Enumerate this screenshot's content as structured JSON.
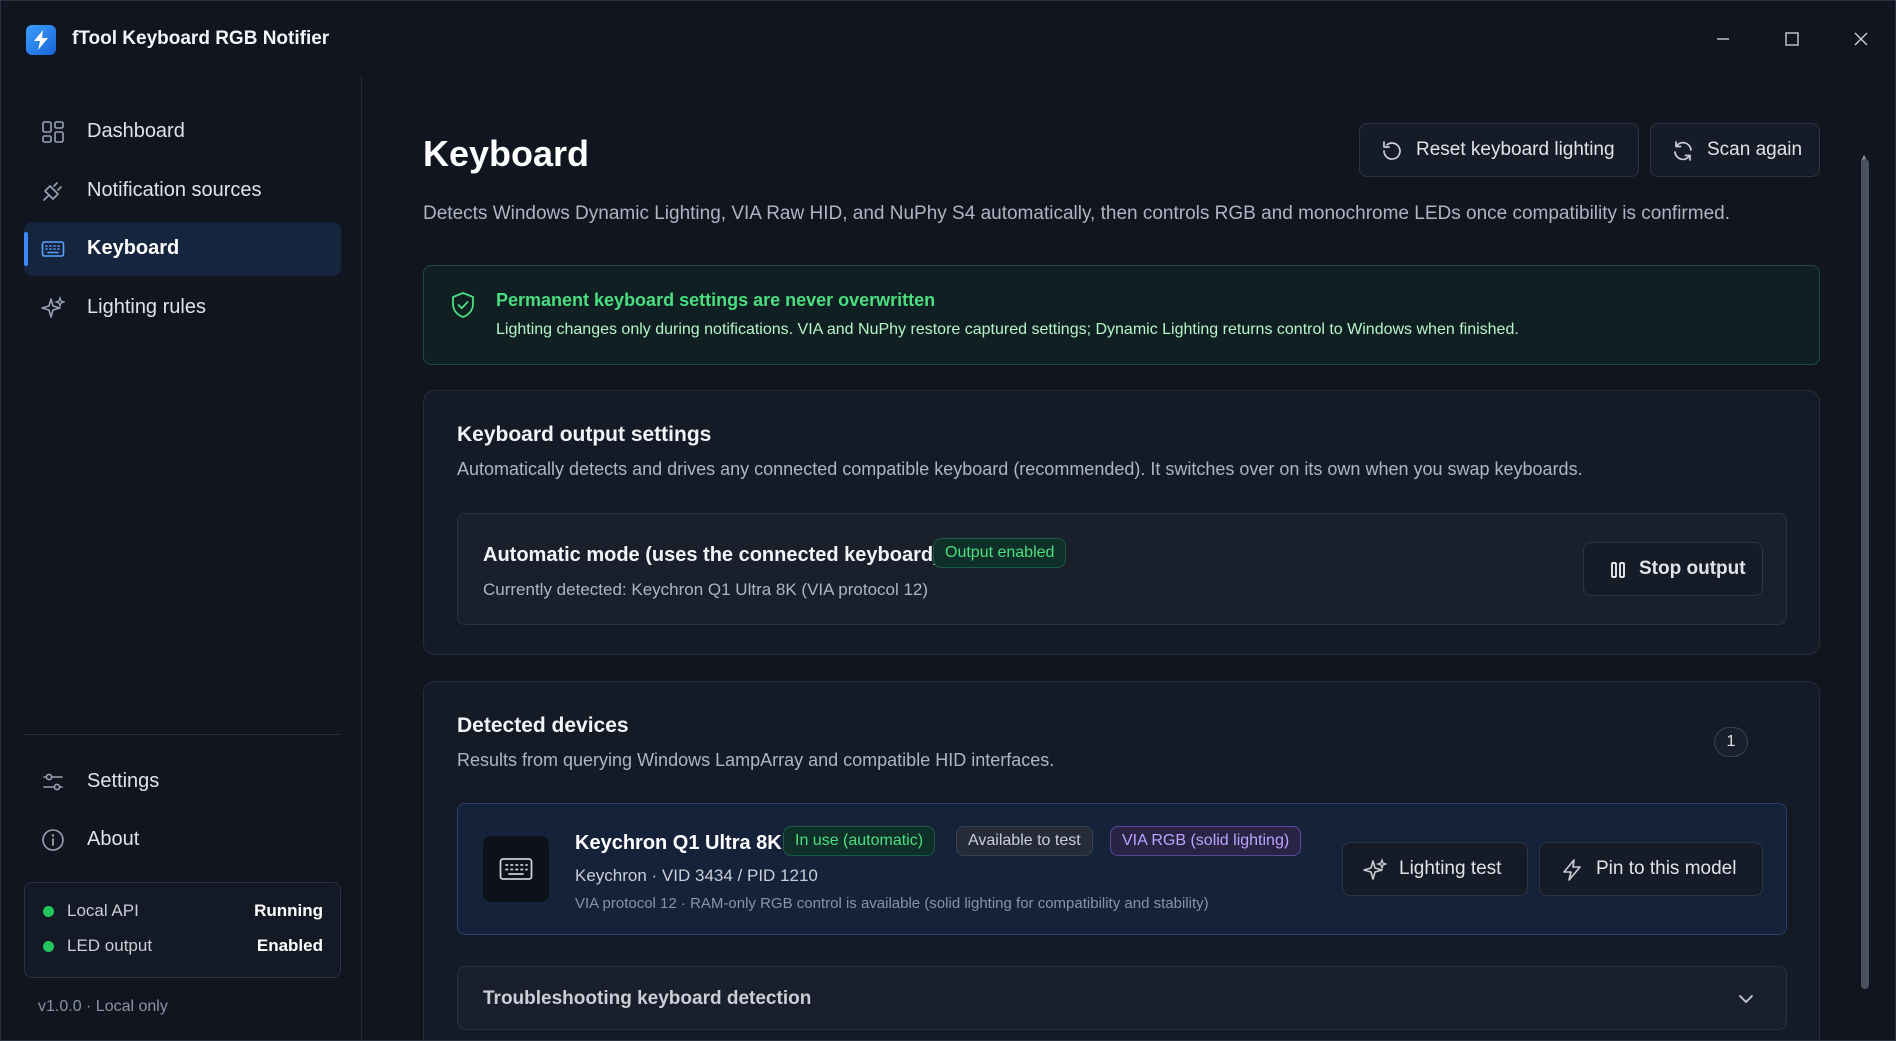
{
  "window": {
    "title": "fTool Keyboard RGB Notifier"
  },
  "sidebar": {
    "items": [
      {
        "label": "Dashboard",
        "icon": "dashboard-icon"
      },
      {
        "label": "Notification sources",
        "icon": "plug-icon"
      },
      {
        "label": "Keyboard",
        "icon": "keyboard-icon",
        "active": true
      },
      {
        "label": "Lighting rules",
        "icon": "sparkles-icon"
      }
    ],
    "bottom_items": [
      {
        "label": "Settings",
        "icon": "sliders-icon"
      },
      {
        "label": "About",
        "icon": "info-icon"
      }
    ],
    "status": [
      {
        "label": "Local API",
        "value": "Running",
        "color": "#22c55e"
      },
      {
        "label": "LED output",
        "value": "Enabled",
        "color": "#22c55e"
      }
    ],
    "version": "v1.0.0 · Local only"
  },
  "main": {
    "title": "Keyboard",
    "reset_button": "Reset keyboard lighting",
    "scan_button": "Scan again",
    "description": "Detects Windows Dynamic Lighting, VIA Raw HID, and NuPhy S4 automatically, then controls RGB and monochrome LEDs once compatibility is confirmed.",
    "alert": {
      "title": "Permanent keyboard settings are never overwritten",
      "text": "Lighting changes only during notifications. VIA and NuPhy restore captured settings; Dynamic Lighting returns control to Windows when finished."
    },
    "output_settings": {
      "title": "Keyboard output settings",
      "subtitle": "Automatically detects and drives any connected compatible keyboard (recommended). It switches over on its own when you swap keyboards.",
      "mode_title": "Automatic mode (uses the connected keyboard)",
      "mode_badge": "Output enabled",
      "mode_detected": "Currently detected: Keychron Q1 Ultra 8K (VIA protocol 12)",
      "stop_button": "Stop output"
    },
    "devices": {
      "title": "Detected devices",
      "subtitle": "Results from querying Windows LampArray and compatible HID interfaces.",
      "count": "1",
      "list": [
        {
          "name": "Keychron Q1 Ultra 8K",
          "badges": [
            "In use (automatic)",
            "Available to test",
            "VIA RGB (solid lighting)"
          ],
          "vendor_line": "Keychron · VID 3434 / PID 1210",
          "detail_line": "VIA protocol 12 · RAM-only RGB control is available (solid lighting for compatibility and stability)",
          "test_button": "Lighting test",
          "pin_button": "Pin to this model"
        }
      ]
    },
    "troubleshooting": {
      "title": "Troubleshooting keyboard detection"
    }
  }
}
